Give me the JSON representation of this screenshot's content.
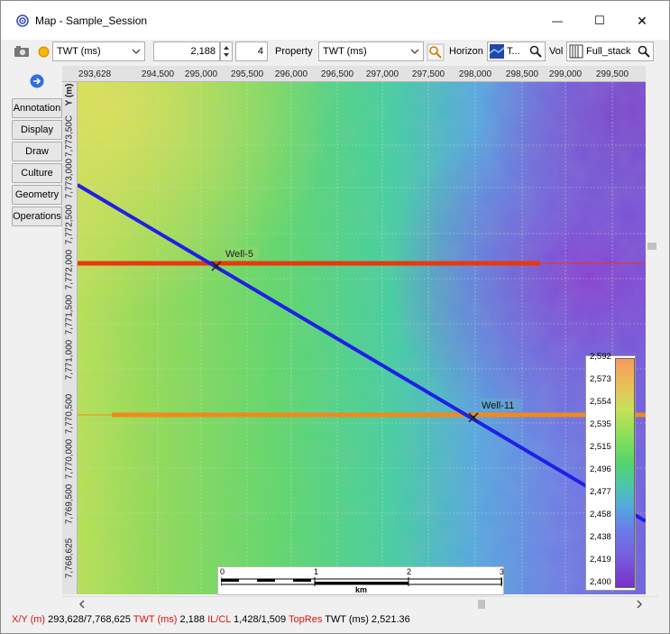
{
  "window": {
    "title": "Map - Sample_Session",
    "minimize_glyph": "—",
    "maximize_glyph": "☐",
    "close_glyph": "✕"
  },
  "toolbar": {
    "domain_value": "TWT (ms)",
    "value_field": "2,188",
    "step_field": "4",
    "property_label": "Property",
    "property_value": "TWT (ms)",
    "horizon_label": "Horizon",
    "horizon_value": "T...",
    "vol_label": "Vol",
    "vol_value": "Full_stack"
  },
  "side_tabs": [
    "Annotation",
    "Display",
    "Draw",
    "Culture",
    "Geometry",
    "Operations"
  ],
  "axes": {
    "x_ticks": [
      "293,628",
      "294,500",
      "295,000",
      "295,500",
      "296,000",
      "296,500",
      "297,000",
      "297,500",
      "298,000",
      "298,500",
      "299,000",
      "299,500"
    ],
    "y_axis_label": "Y (m)",
    "y_ticks": [
      "7,773,50C",
      "7,773,000",
      "7,772,500",
      "7,772,000",
      "7,771,500",
      "7,771,000",
      "7,770,500",
      "7,770,000",
      "7,769,500",
      "7,768,625"
    ]
  },
  "wells": [
    {
      "name": "Well-5"
    },
    {
      "name": "Well-11"
    }
  ],
  "colorbar": {
    "labels": [
      "2,592",
      "2,573",
      "2,554",
      "2,535",
      "2,515",
      "2,496",
      "2,477",
      "2,458",
      "2,438",
      "2,419",
      "2,400"
    ]
  },
  "scalebar": {
    "ticks": [
      "0",
      "1",
      "2",
      "3"
    ],
    "unit": "km"
  },
  "status": {
    "xy_label": "X/Y (m)",
    "xy_value": "293,628/7,768,625",
    "twt_label": "TWT (ms)",
    "twt_value": "2,188",
    "ilcl_label": "IL/CL",
    "ilcl_value": "1,428/1,509",
    "topres_label": "TopRes",
    "topres_value": "TWT (ms) 2,521.36"
  },
  "colors": {
    "seismic_line": "#1f1fe6",
    "well5_line": "#e8380e",
    "well11_line": "#f08a1c"
  }
}
